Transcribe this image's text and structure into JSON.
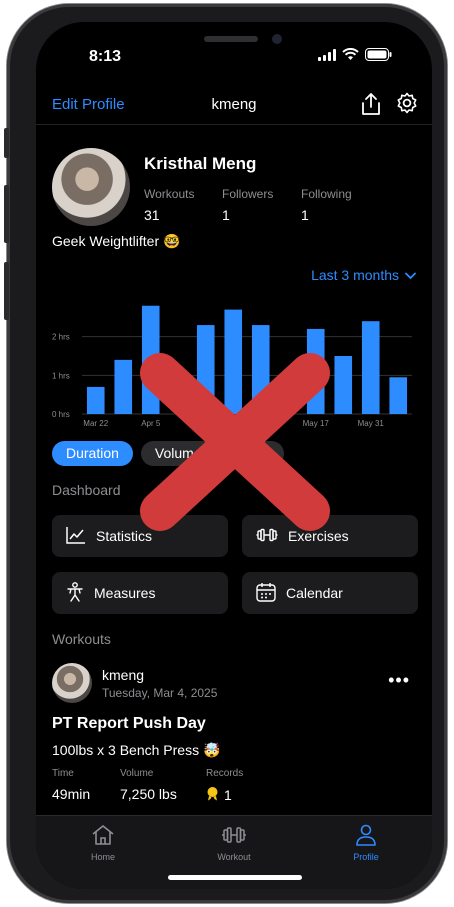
{
  "status": {
    "time": "8:13"
  },
  "nav": {
    "edit_label": "Edit Profile",
    "title": "kmeng"
  },
  "profile": {
    "name": "Kristhal Meng",
    "stats": [
      {
        "label": "Workouts",
        "value": "31"
      },
      {
        "label": "Followers",
        "value": "1"
      },
      {
        "label": "Following",
        "value": "1"
      }
    ],
    "bio": "Geek Weightlifter 🤓"
  },
  "range": {
    "label": "Last 3 months"
  },
  "chart_data": {
    "type": "bar",
    "x": [
      "Mar 22",
      "Mar 29",
      "Apr 5",
      "Apr 12",
      "Apr 19",
      "Apr 26",
      "May 3",
      "May 10",
      "May 17",
      "May 24",
      "May 31",
      "Jun 7"
    ],
    "x_tick_labels": [
      "Mar 22",
      "Apr 5",
      "May 17",
      "May 31"
    ],
    "values": [
      0.7,
      1.4,
      2.8,
      0.0,
      2.3,
      2.7,
      2.3,
      0.0,
      2.2,
      1.5,
      2.4,
      0.95
    ],
    "y_ticks": [
      "0 hrs",
      "1 hrs",
      "2 hrs"
    ],
    "ylim": [
      0,
      3
    ],
    "color": "#2d8cff",
    "grid": true
  },
  "chips": [
    "Duration",
    "Volume",
    "Reps"
  ],
  "dashboard": {
    "title": "Dashboard",
    "tiles": [
      {
        "label": "Statistics",
        "icon": "chart-line-icon"
      },
      {
        "label": "Exercises",
        "icon": "dumbbell-icon"
      },
      {
        "label": "Measures",
        "icon": "body-measure-icon"
      },
      {
        "label": "Calendar",
        "icon": "calendar-icon"
      }
    ]
  },
  "workouts": {
    "title": "Workouts",
    "post": {
      "user": "kmeng",
      "date": "Tuesday, Mar 4, 2025",
      "title": "PT Report Push Day",
      "description": "100lbs x 3 Bench Press 🤯",
      "metrics": [
        {
          "label": "Time",
          "value": "49min"
        },
        {
          "label": "Volume",
          "value": "7,250 lbs"
        },
        {
          "label": "Records",
          "value": "1"
        }
      ]
    }
  },
  "tabs": [
    {
      "label": "Home"
    },
    {
      "label": "Workout"
    },
    {
      "label": "Profile"
    }
  ]
}
